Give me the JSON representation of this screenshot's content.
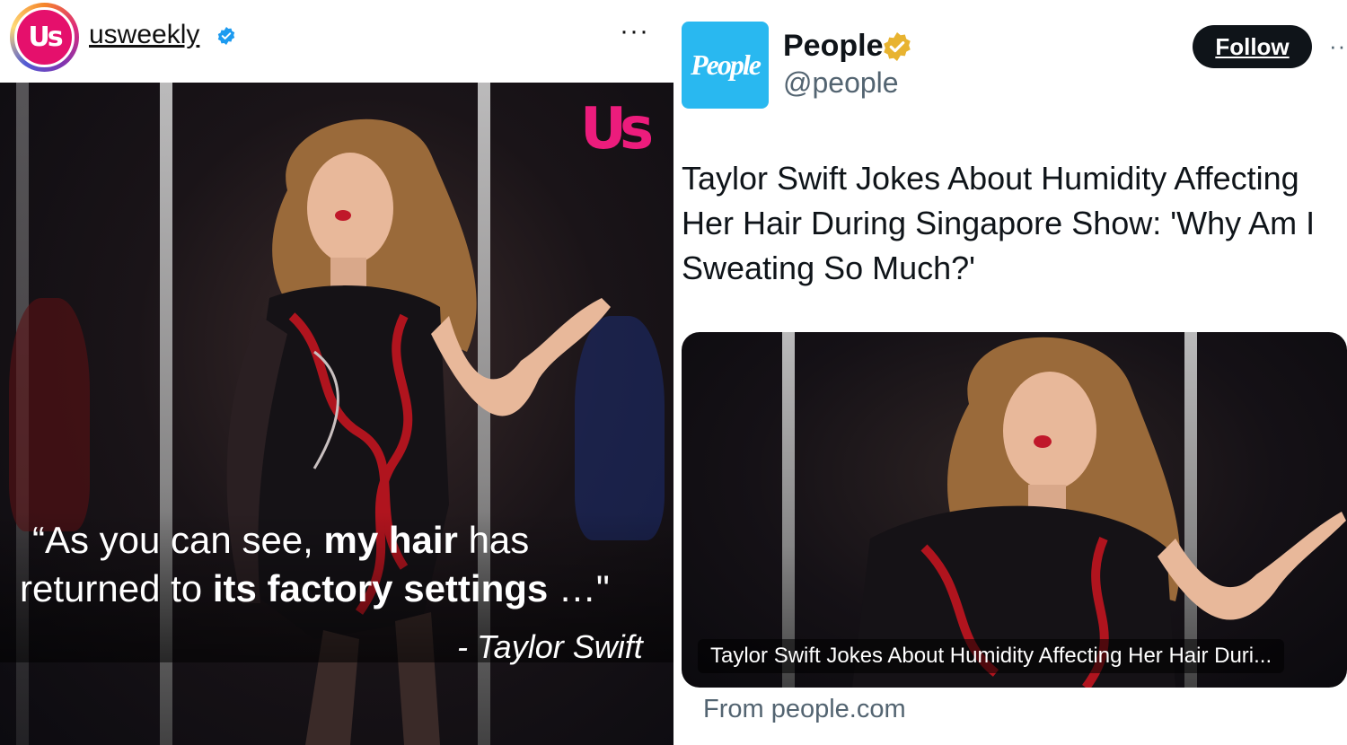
{
  "left": {
    "avatar_text": "Us",
    "username": "usweekly",
    "more_label": "···",
    "brand_logo_text": "Us",
    "quote": {
      "line1_pre": "“As you can see, ",
      "line1_bold": "my hair",
      "line1_post": " has",
      "line2_pre": "returned to ",
      "line2_bold": "its factory settings",
      "line2_post": " …\"",
      "attribution": "- Taylor Swift"
    }
  },
  "right": {
    "avatar_text": "People",
    "display_name": "People",
    "handle": "@people",
    "follow_label": "Follow",
    "more_label": "··",
    "post_text": "Taylor Swift Jokes About Humidity Affecting Her Hair During Singapore Show: 'Why Am I Sweating So Much?'",
    "card_caption": "Taylor Swift Jokes About Humidity Affecting Her Hair Duri...",
    "card_source": "From people.com"
  },
  "colors": {
    "us_pink": "#ec1c7c",
    "people_blue": "#29b8f0",
    "verified_blue": "#1d9bf0",
    "verified_gold": "#e8b330",
    "follow_bg": "#0f1419"
  },
  "icons": {
    "ig_verified": "verified-badge-icon",
    "x_verified": "gold-verified-badge-icon",
    "more": "more-dots-icon"
  }
}
